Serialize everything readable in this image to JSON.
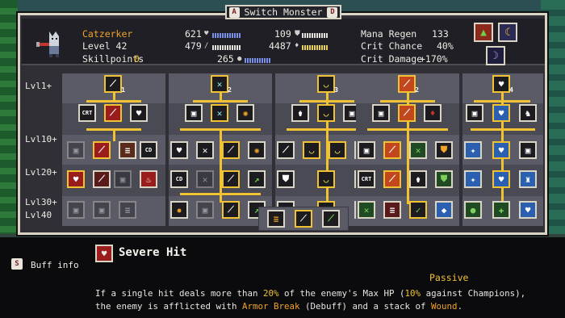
{
  "window": {
    "title": "Switch Monster",
    "key_left": "A",
    "key_right": "D"
  },
  "monster": {
    "name": "Catzerker",
    "level": "Level 42",
    "skillpoints_label": "Skillpoints",
    "skillpoints_value": "0"
  },
  "stats": {
    "health": "621",
    "attack": "479",
    "defense": "109",
    "mana": "4487",
    "speed": "265",
    "mana_regen_label": "Mana Regen",
    "mana_regen_value": "133",
    "crit_chance_label": "Crit Chance",
    "crit_chance_value": "40%",
    "crit_damage_label": "Crit Damage",
    "crit_damage_value": "+170%"
  },
  "level_labels": [
    "Lvl1+",
    "Lvl10+",
    "Lvl20+",
    "Lvl30+",
    "Lvl40"
  ],
  "skill_tree": {
    "tier_labels": [
      "1",
      "2",
      "3",
      "2",
      "4",
      "3"
    ],
    "crt_label": "CRT",
    "cd_label": "CD"
  },
  "footer": {
    "key": "S",
    "key_label": "Buff info",
    "skill_name": "Severe Hit",
    "skill_type": "Passive",
    "desc_line1_a": "If a single hit deals more than ",
    "desc_pct1": "20%",
    "desc_line1_b": " of the enemy's Max HP (",
    "desc_pct2": "10%",
    "desc_line1_c": " against Champions),",
    "desc_line2_a": "the enemy is afflicted with ",
    "desc_kw1": "Armor Break",
    "desc_line2_b": " (Debuff) and a stack of ",
    "desc_kw2": "Wound",
    "desc_line2_c": "."
  },
  "colors": {
    "accent_gold": "#f1c232",
    "accent_orange": "#f0a428",
    "panel": "#2f2f35",
    "frame": "#d9d4c4"
  }
}
